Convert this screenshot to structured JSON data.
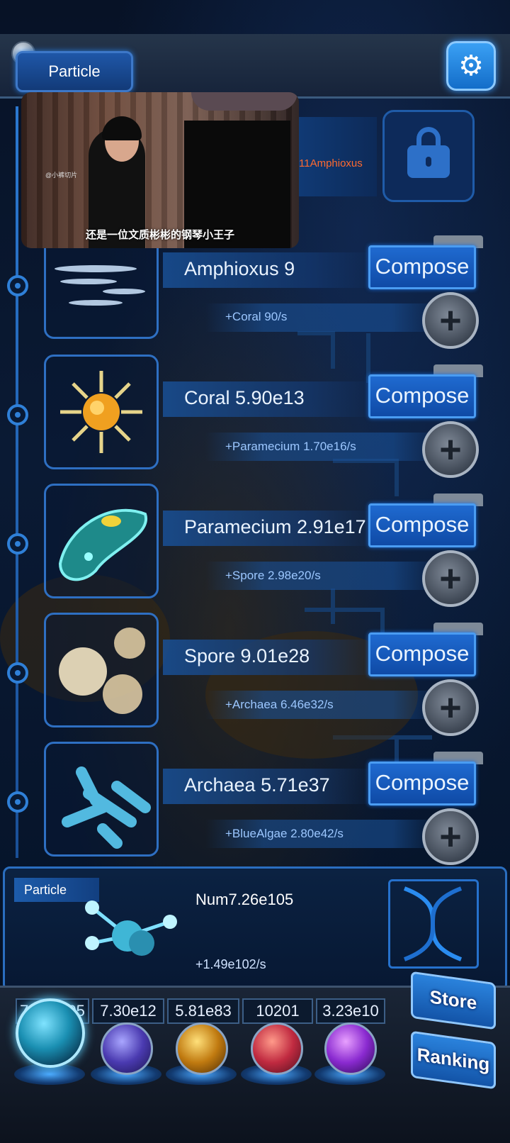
{
  "header": {
    "title": "Particle",
    "settings_icon": "gear-icon"
  },
  "video_overlay": {
    "watermark": "@小裤切片",
    "subtitle": "还是一位文质彬彬的钢琴小王子"
  },
  "locked_item": {
    "text": "11Amphioxus",
    "icon": "lock-icon"
  },
  "creatures": [
    {
      "name": "Amphioxus 9",
      "rate": "+Coral 90/s",
      "compose": "Compose"
    },
    {
      "name": "Coral 5.90e13",
      "rate": "+Paramecium 1.70e16/s",
      "compose": "Compose"
    },
    {
      "name": "Paramecium 2.91e17",
      "rate": "+Spore 2.98e20/s",
      "compose": "Compose"
    },
    {
      "name": "Spore 9.01e28",
      "rate": "+Archaea 6.46e32/s",
      "compose": "Compose"
    },
    {
      "name": "Archaea 5.71e37",
      "rate": "+BlueAlgae 2.80e42/s",
      "compose": "Compose"
    }
  ],
  "particle_panel": {
    "label": "Particle",
    "num": "Num7.26e105",
    "rate": "+1.49e102/s"
  },
  "currencies": [
    "7.26e105",
    "7.30e12",
    "5.81e83",
    "10201",
    "3.23e10"
  ],
  "side_buttons": {
    "store": "Store",
    "ranking": "Ranking"
  },
  "colors": {
    "accent": "#2f80d8",
    "locked_text": "#ff6a30",
    "background": "#071226"
  }
}
